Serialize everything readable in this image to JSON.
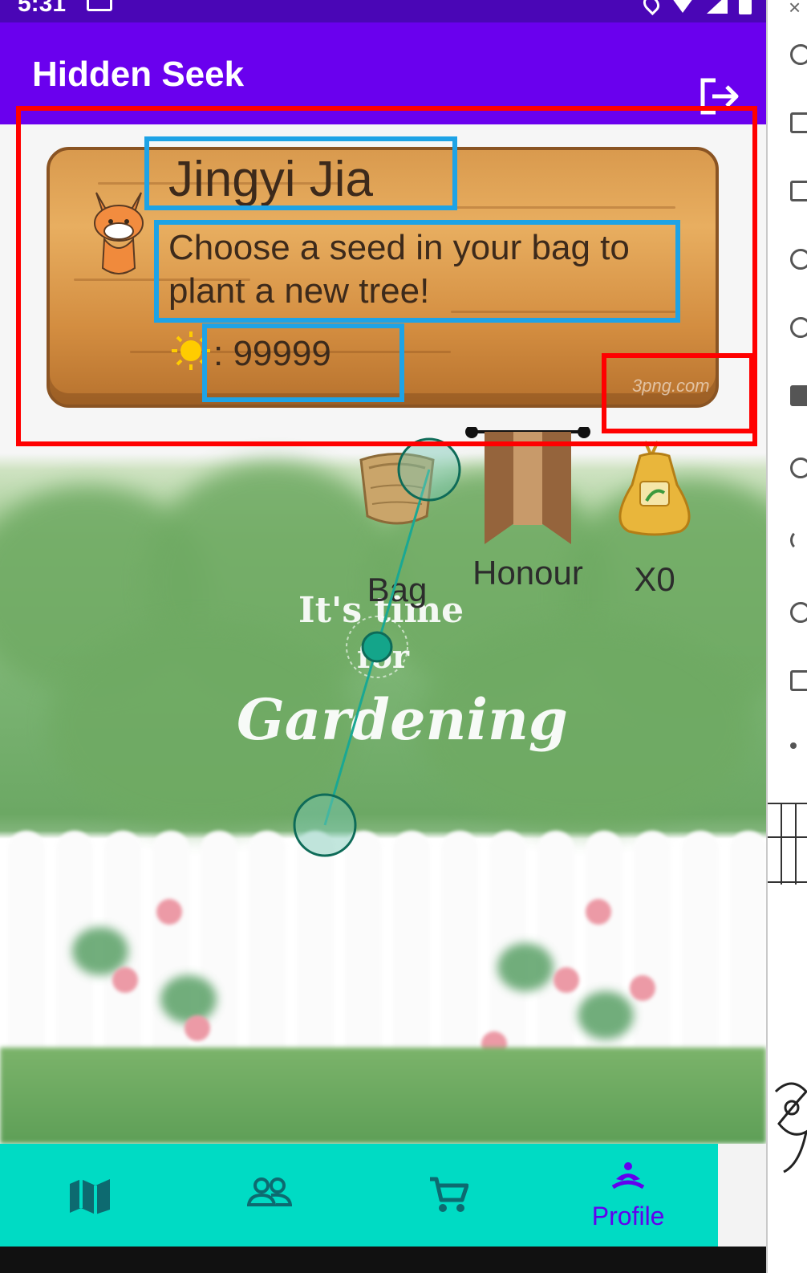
{
  "status_bar": {
    "time": "5:31"
  },
  "app_bar": {
    "title": "Hidden Seek"
  },
  "profile_card": {
    "name": "Jingyi Jia",
    "hint": "Choose a seed in your bag to plant a new tree!",
    "points": ": 99999",
    "watermark": "3png.com"
  },
  "garden": {
    "slogan_line1": "It's time",
    "slogan_line2": "for",
    "slogan_line3": "Gardening"
  },
  "items": {
    "bag_label": "Bag",
    "honour_label": "Honour",
    "seed_label": "X0"
  },
  "bottom_nav": {
    "items": [
      {
        "icon": "map-icon",
        "label": ""
      },
      {
        "icon": "friends-icon",
        "label": ""
      },
      {
        "icon": "cart-icon",
        "label": ""
      },
      {
        "icon": "profile-icon",
        "label": "Profile"
      }
    ],
    "active_index": 3
  },
  "side_panel": {
    "close_glyph": "×"
  },
  "colors": {
    "status_bar": "#4a06b6",
    "app_bar": "#6a00ee",
    "bottom_nav": "#00dbc4",
    "active_nav": "#6200ee",
    "annotation_red": "#ff0000",
    "annotation_blue": "#1ea3e6"
  }
}
